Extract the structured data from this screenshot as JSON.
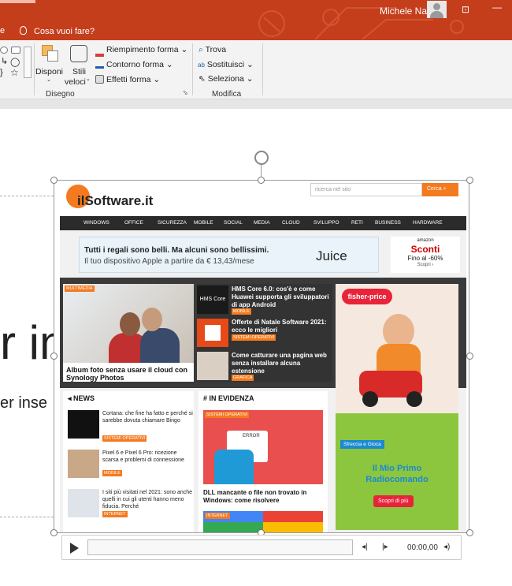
{
  "titlebar": {
    "user_name": "Michele Nasi",
    "tell_me": "Cosa vuoi fare?",
    "tab_fragment": "e"
  },
  "ribbon": {
    "draw_group": {
      "label": "Disegno",
      "disponi": "Disponi",
      "stili_line1": "Stili",
      "stili_line2": "veloci",
      "fill": "Riempimento forma",
      "outline": "Contorno forma",
      "effects": "Effetti forma"
    },
    "edit_group": {
      "label": "Modifica",
      "find": "Trova",
      "replace": "Sostituisci",
      "select": "Seleziona"
    }
  },
  "slide": {
    "big_text": "r in",
    "med_text": "er inse"
  },
  "site": {
    "logo": "ilSoftware.it",
    "search_placeholder": "ricerca nel sito",
    "search_button": "Cerca",
    "nav": [
      "WINDOWS",
      "OFFICE",
      "SICUREZZA",
      "MOBILE",
      "SOCIAL",
      "MEDIA",
      "CLOUD",
      "SVILUPPO",
      "RETI",
      "BUSINESS",
      "HARDWARE"
    ],
    "ad": {
      "line1": "Tutti i regali sono belli. Ma alcuni sono bellissimi.",
      "line2": "Il tuo dispositivo Apple a partire da € 13,43/mese",
      "brand": "Juice"
    },
    "ad_side": {
      "brand": "amazon",
      "title": "Sconti",
      "sub": "Fino al -60%",
      "cta": "Scopri ›"
    },
    "feature": {
      "tag": "MULTIMEDIA",
      "title": "Album foto senza usare il cloud con Synology Photos"
    },
    "mid": [
      {
        "title": "HMS Core 6.0: cos'è e come Huawei supporta gli sviluppatori di app Android",
        "tag": "MOBILE"
      },
      {
        "title": "Offerte di Natale Software 2021: ecco le migliori",
        "tag": "SISTEMI OPERATIVI"
      },
      {
        "title": "Come catturare una pagina web senza installare alcuna estensione",
        "tag": "GRAFICA"
      }
    ],
    "mid_thumb_label": "HMS Core",
    "toy_ad": {
      "brand": "fisher-price",
      "badge": "Sfreccia e Gioca",
      "title_line1": "Il Mio Primo",
      "title_line2": "Radiocomando",
      "cta": "Scopri di più"
    },
    "news": {
      "title": "NEWS",
      "items": [
        {
          "title": "Cortana: che fine ha fatto e perché si sarebbe dovuta chiamare Bingo",
          "tag": "SISTEMI OPERATIVI"
        },
        {
          "title": "Pixel 6 e Pixel 6 Pro: ricezione scarsa e problemi di connessione",
          "tag": "MOBILE"
        },
        {
          "title": "I siti più visitati nel 2021: sono anche quelli in cui gli utenti hanno meno fiducia. Perché",
          "tag": "INTERNET"
        }
      ]
    },
    "evidence": {
      "title": "IN EVIDENZA",
      "tag": "SISTEMI OPERATIVI",
      "error_label": "ERROR",
      "item_title": "DLL mancante o file non trovato in Windows: come risolvere",
      "tag2": "INTERNET"
    }
  },
  "media": {
    "time": "00:00,00"
  }
}
